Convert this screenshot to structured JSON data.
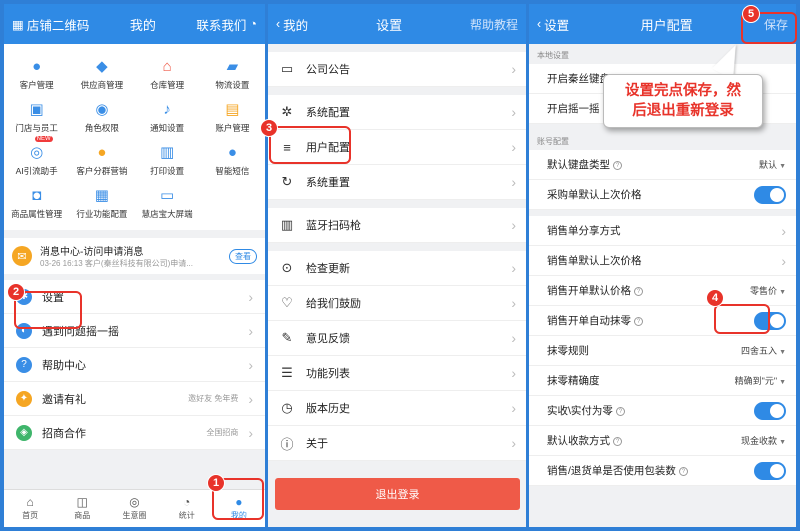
{
  "panel1": {
    "header": {
      "left": "店铺二维码",
      "center": "我的",
      "right": "联系我们"
    },
    "grid": [
      {
        "label": "客户管理",
        "icon": "person-icon",
        "color": "#3a8ee6"
      },
      {
        "label": "供应商管理",
        "icon": "cube-icon",
        "color": "#3a8ee6"
      },
      {
        "label": "仓库管理",
        "icon": "house-icon",
        "color": "#ef5a48"
      },
      {
        "label": "物流设置",
        "icon": "truck-icon",
        "color": "#3a8ee6"
      },
      {
        "label": "门店与员工",
        "icon": "store-icon",
        "color": "#3a8ee6"
      },
      {
        "label": "角色权限",
        "icon": "role-icon",
        "color": "#3a8ee6"
      },
      {
        "label": "通知设置",
        "icon": "bell-icon",
        "color": "#3a8ee6"
      },
      {
        "label": "账户管理",
        "icon": "account-icon",
        "color": "#f5a623"
      },
      {
        "label": "AI引流助手",
        "icon": "ai-icon",
        "color": "#3a8ee6",
        "badge": "NEW"
      },
      {
        "label": "客户分群营销",
        "icon": "group-icon",
        "color": "#f5a623"
      },
      {
        "label": "打印设置",
        "icon": "printer-icon",
        "color": "#3a8ee6"
      },
      {
        "label": "智能短信",
        "icon": "sms-icon",
        "color": "#3a8ee6"
      },
      {
        "label": "商品属性管理",
        "icon": "tag-icon",
        "color": "#3a8ee6"
      },
      {
        "label": "行业功能配置",
        "icon": "config-icon",
        "color": "#3a8ee6"
      },
      {
        "label": "慧店宝大屏端",
        "icon": "screen-icon",
        "color": "#3a8ee6"
      }
    ],
    "message": {
      "title": "消息中心-访问申请消息",
      "sub": "03-26 16:13   客户(秦丝科技有限公司)申请...",
      "button": "查看"
    },
    "menu": [
      {
        "label": "设置",
        "hint": "",
        "icon": "gear-icon",
        "color": "#3a8ee6"
      },
      {
        "label": "遇到问题摇一摇",
        "hint": "",
        "icon": "shake-icon",
        "color": "#3a8ee6"
      },
      {
        "label": "帮助中心",
        "hint": "",
        "icon": "help-icon",
        "color": "#3a8ee6"
      },
      {
        "label": "邀请有礼",
        "hint": "邀好友 免年费",
        "icon": "gift-icon",
        "color": "#f5a623"
      },
      {
        "label": "招商合作",
        "hint": "全国招商",
        "icon": "partner-icon",
        "color": "#3fb56b"
      }
    ],
    "tabs": [
      {
        "label": "首页",
        "icon": "home-icon"
      },
      {
        "label": "商品",
        "icon": "bag-icon"
      },
      {
        "label": "生意圈",
        "icon": "circle-icon"
      },
      {
        "label": "统计",
        "icon": "chart-icon"
      },
      {
        "label": "我的",
        "icon": "user-icon"
      }
    ]
  },
  "panel2": {
    "header": {
      "back": "我的",
      "title": "设置",
      "right": "帮助教程"
    },
    "groups": [
      [
        {
          "label": "公司公告",
          "icon": "notice-icon"
        }
      ],
      [
        {
          "label": "系统配置",
          "icon": "settings-icon"
        },
        {
          "label": "用户配置",
          "icon": "sliders-icon"
        },
        {
          "label": "系统重置",
          "icon": "reset-icon"
        }
      ],
      [
        {
          "label": "蓝牙扫码枪",
          "icon": "barcode-icon"
        }
      ],
      [
        {
          "label": "检查更新",
          "icon": "update-icon"
        },
        {
          "label": "给我们鼓励",
          "icon": "heart-icon"
        },
        {
          "label": "意见反馈",
          "icon": "feedback-icon"
        },
        {
          "label": "功能列表",
          "icon": "list-icon"
        },
        {
          "label": "版本历史",
          "icon": "clock-icon"
        },
        {
          "label": "关于",
          "icon": "info-icon"
        }
      ]
    ],
    "logout": "退出登录"
  },
  "panel3": {
    "header": {
      "back": "设置",
      "title": "用户配置",
      "right": "保存"
    },
    "section_local": "本地设置",
    "local_rows": [
      {
        "label": "开启秦丝键盘"
      },
      {
        "label": "开启摇一摇"
      }
    ],
    "section_account": "账号配置",
    "account_rows": [
      {
        "label": "默认键盘类型",
        "help": true,
        "type": "select",
        "value": "默认"
      },
      {
        "label": "采购单默认上次价格",
        "type": "toggle"
      },
      {
        "label": "销售单分享方式",
        "type": "chevron"
      },
      {
        "label": "销售单默认上次价格",
        "type": "chevron"
      },
      {
        "label": "销售开单默认价格",
        "help": true,
        "type": "select",
        "value": "零售价"
      },
      {
        "label": "销售开单自动抹零",
        "help": true,
        "type": "toggle"
      },
      {
        "label": "抹零规则",
        "type": "select",
        "value": "四舍五入"
      },
      {
        "label": "抹零精确度",
        "type": "select",
        "value": "精确到\"元\""
      },
      {
        "label": "实收\\实付为零",
        "help": true,
        "type": "toggle"
      },
      {
        "label": "默认收款方式",
        "help": true,
        "type": "select",
        "value": "现金收款"
      },
      {
        "label": "销售/退货单是否使用包装数",
        "help": true,
        "type": "toggle"
      }
    ]
  },
  "annotations": {
    "steps": [
      "1",
      "2",
      "3",
      "4",
      "5"
    ],
    "callout": [
      "设置完点保存，然",
      "后退出重新登录"
    ],
    "accent": "#e8332a"
  }
}
